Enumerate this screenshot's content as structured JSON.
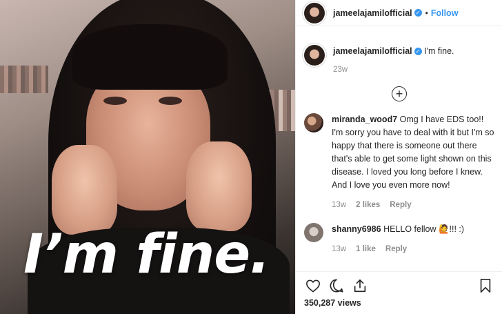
{
  "media": {
    "caption": "I’m fine."
  },
  "header": {
    "username": "jameelajamilofficial",
    "dot": "•",
    "follow_label": "Follow"
  },
  "post": {
    "username": "jameelajamilofficial",
    "text": "I'm fine.",
    "age": "23w"
  },
  "load_more": {
    "icon": "plus-circle-icon"
  },
  "comments": [
    {
      "username": "miranda_wood7",
      "text": "Omg I have EDS too!! I'm sorry you have to deal with it but I'm so happy that there is someone out there that's able to get some light shown on this disease. I loved you long before I knew. And I love you even more now!",
      "age": "13w",
      "likes": "2 likes",
      "reply": "Reply"
    },
    {
      "username": "shanny6986",
      "text": "HELLO fellow 🙋!!! :)",
      "age": "13w",
      "likes": "1 like",
      "reply": "Reply"
    }
  ],
  "actions": {
    "icons": [
      "heart-icon",
      "comment-icon",
      "share-icon",
      "bookmark-icon"
    ],
    "views": "350,287 views"
  },
  "colors": {
    "link_blue": "#3897f0",
    "text": "#262626",
    "muted": "#8e8e8e"
  }
}
